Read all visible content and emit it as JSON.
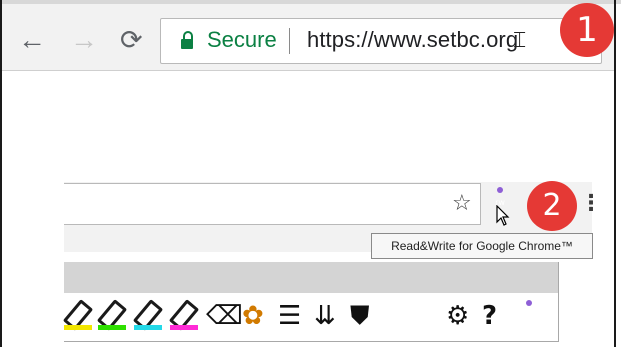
{
  "top_toolbar": {
    "back_icon": "arrow-left",
    "forward_icon": "arrow-right",
    "reload_icon": "reload",
    "secure_label": "Secure",
    "url": "https://www.setbc.org",
    "step_badge": "1"
  },
  "extension_toolbar": {
    "star_icon": "star-outline",
    "extension_icon": "puzzle-rw",
    "menu_icon": "vertical-dots",
    "step_badge": "2",
    "extension_label": "rw",
    "tooltip": "Read&Write for Google Chrome™"
  },
  "readwrite_toolbar": {
    "tools": [
      {
        "name": "highlighter-yellow",
        "color": "#f2e600"
      },
      {
        "name": "highlighter-green",
        "color": "#2ee000"
      },
      {
        "name": "highlighter-cyan",
        "color": "#23d9e8"
      },
      {
        "name": "highlighter-pink",
        "color": "#ff2bd6"
      },
      {
        "name": "clear-highlights"
      },
      {
        "name": "collect-highlights"
      },
      {
        "name": "vocabulary-list"
      },
      {
        "name": "text-sort"
      },
      {
        "name": "dictionary"
      },
      {
        "name": "settings"
      },
      {
        "name": "help"
      },
      {
        "name": "read-write-menu"
      }
    ],
    "ext_label": "rw",
    "help_glyph": "?"
  },
  "colors": {
    "secure_green": "#0b8043",
    "badge_red": "#e53935",
    "extension_purple": "#8e5fd6"
  }
}
